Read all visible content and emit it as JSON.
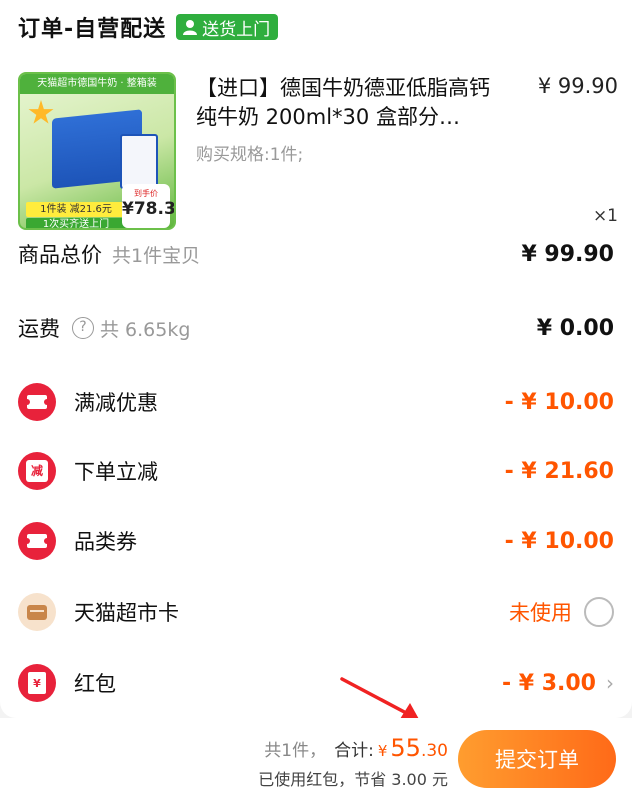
{
  "header": {
    "title": "订单-自营配送",
    "badge": "送货上门"
  },
  "product": {
    "image_top_text": "天猫超市德国牛奶 · 整箱装",
    "image_offer_1": "1件装 减21.6元",
    "image_offer_2": "1次买齐送上门",
    "image_price_tag": "到手价",
    "image_price": "¥78.3",
    "title": "【进口】德国牛奶德亚低脂高钙纯牛奶 200ml*30 盒部分…",
    "price": "¥ 99.90",
    "spec": "购买规格:1件;",
    "quantity": "×1"
  },
  "summary": {
    "goods_total_label": "商品总价",
    "goods_total_sub": "共1件宝贝",
    "goods_total_value": "¥ 99.90",
    "shipping_label": "运费",
    "shipping_help": "?",
    "shipping_weight": "共 6.65kg",
    "shipping_value": "¥ 0.00"
  },
  "discounts": [
    {
      "label": "满减优惠",
      "value": "- ¥ 10.00",
      "icon": "ticket-icon"
    },
    {
      "label": "下单立减",
      "value": "- ¥ 21.60",
      "icon": "reduce-icon",
      "icon_text": "减"
    },
    {
      "label": "品类券",
      "value": "- ¥ 10.00",
      "icon": "ticket-icon"
    },
    {
      "label": "天猫超市卡",
      "value": "未使用",
      "icon": "wallet-icon"
    },
    {
      "label": "红包",
      "value": "- ¥ 3.00",
      "icon": "red-envelope-icon",
      "icon_text": "¥",
      "chevron": "›"
    }
  ],
  "footer": {
    "count": "共1件，",
    "total_label": "合计:",
    "total_yen": "¥",
    "total_int": "55",
    "total_dec": ".30",
    "saving": "已使用红包，节省 3.00 元",
    "submit_label": "提交订单"
  },
  "colors": {
    "accent": "#ff5500",
    "badge_green": "#2fae3e",
    "icon_red": "#e8223b",
    "submit_start": "#ff9d2f",
    "submit_end": "#ff6a18"
  }
}
